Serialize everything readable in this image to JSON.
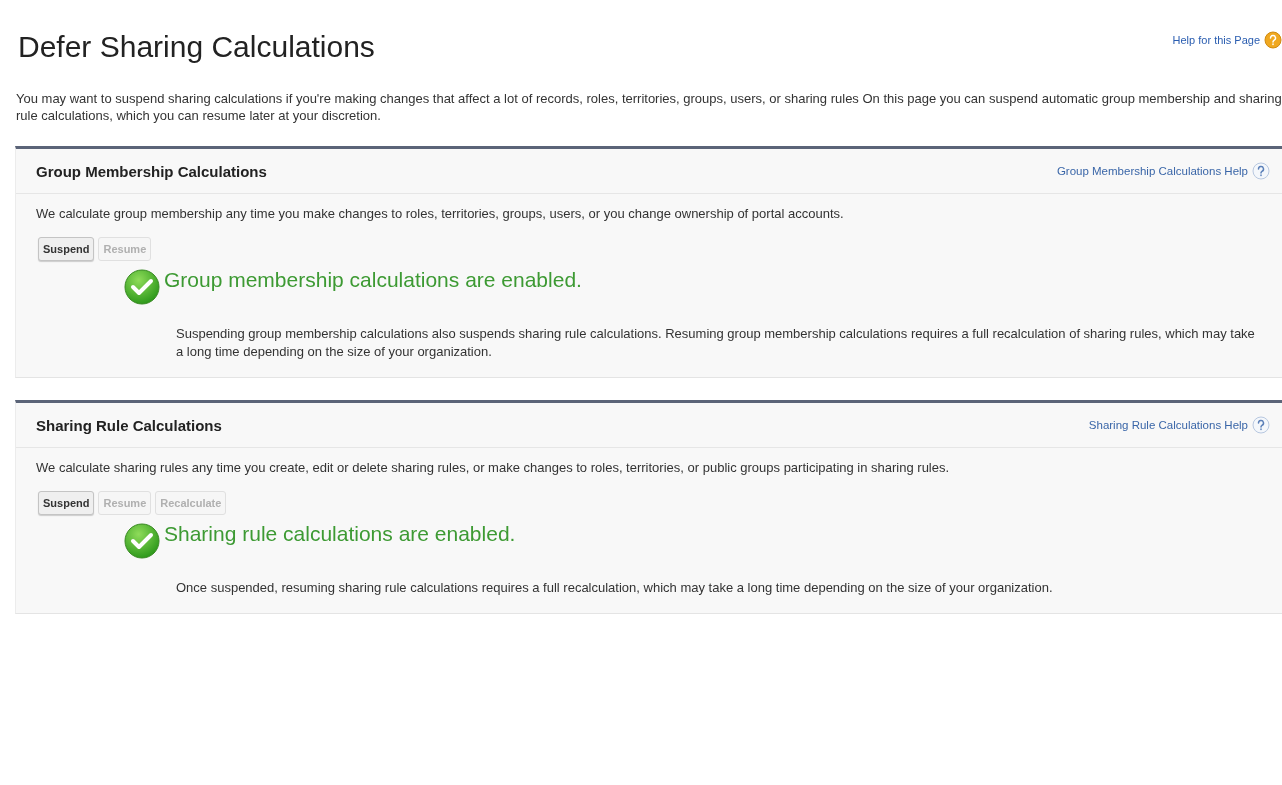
{
  "page": {
    "title": "Defer Sharing Calculations",
    "help_link": "Help for this Page",
    "intro": "You may want to suspend sharing calculations if you're making changes that affect a lot of records, roles, territories, groups, users, or sharing rules On this page you can suspend automatic group membership and sharing rule calculations, which you can resume later at your discretion."
  },
  "sections": [
    {
      "title": "Group Membership Calculations",
      "help_link": "Group Membership Calculations Help",
      "description": "We calculate group membership any time you make changes to roles, territories, groups, users, or you change ownership of portal accounts.",
      "buttons": [
        {
          "label": "Suspend",
          "disabled": false
        },
        {
          "label": "Resume",
          "disabled": true
        }
      ],
      "status": {
        "kind": "enabled",
        "message": "Group membership calculations are enabled."
      },
      "note": "Suspending group membership calculations also suspends sharing rule calculations. Resuming group membership calculations requires a full recalculation of sharing rules, which may take a long time depending on the size of your organization."
    },
    {
      "title": "Sharing Rule Calculations",
      "help_link": "Sharing Rule Calculations Help",
      "description": "We calculate sharing rules any time you create, edit or delete sharing rules, or make changes to roles, territories, or public groups participating in sharing rules.",
      "buttons": [
        {
          "label": "Suspend",
          "disabled": false
        },
        {
          "label": "Resume",
          "disabled": true
        },
        {
          "label": "Recalculate",
          "disabled": true
        }
      ],
      "status": {
        "kind": "enabled",
        "message": "Sharing rule calculations are enabled."
      },
      "note": "Once suspended, resuming sharing rule calculations requires a full recalculation, which may take a long time depending on the size of your organization."
    }
  ]
}
